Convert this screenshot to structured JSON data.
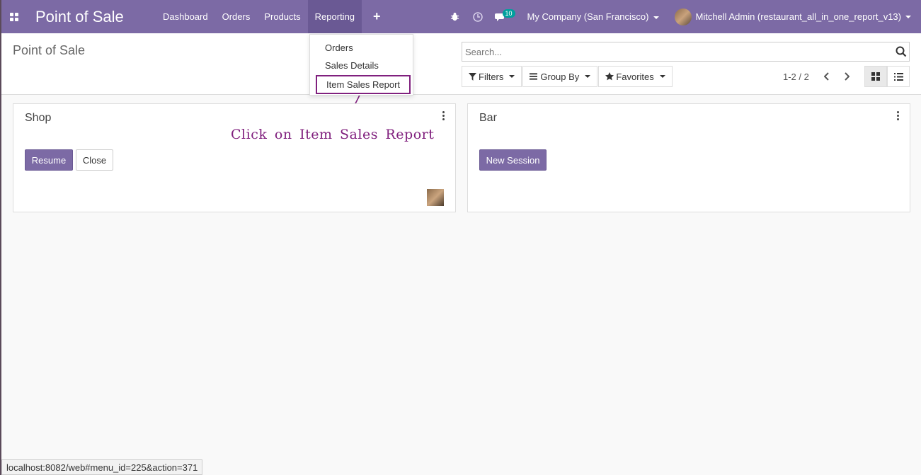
{
  "navbar": {
    "app_title": "Point of Sale",
    "menu": [
      "Dashboard",
      "Orders",
      "Products",
      "Reporting"
    ],
    "plus": "+",
    "messages_badge": "10",
    "company": "My Company (San Francisco)",
    "user": "Mitchell Admin (restaurant_all_in_one_report_v13)",
    "bg_color": "#7c6aa5"
  },
  "control_panel": {
    "breadcrumb": "Point of Sale",
    "search_placeholder": "Search...",
    "filters_label": "Filters",
    "groupby_label": "Group By",
    "favorites_label": "Favorites",
    "pager": "1-2 / 2"
  },
  "reporting_dropdown": {
    "items": [
      "Orders",
      "Sales Details",
      "Item Sales Report"
    ]
  },
  "cards": [
    {
      "title": "Shop",
      "resume_label": "Resume",
      "close_label": "Close"
    },
    {
      "title": "Bar",
      "new_session_label": "New Session"
    }
  ],
  "annotation": "Click on Item Sales Report",
  "status_url": "localhost:8082/web#menu_id=225&action=371"
}
